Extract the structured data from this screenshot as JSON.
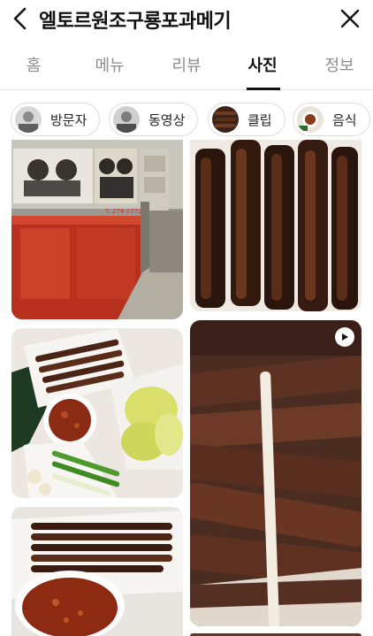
{
  "header": {
    "title": "엘토르원조구룡포과메기",
    "back_icon": "chevron-left-icon",
    "close_icon": "close-icon"
  },
  "tabs": [
    {
      "label": "홈",
      "active": false
    },
    {
      "label": "메뉴",
      "active": false
    },
    {
      "label": "리뷰",
      "active": false
    },
    {
      "label": "사진",
      "active": true
    },
    {
      "label": "정보",
      "active": false
    }
  ],
  "filters": [
    {
      "label": "방문자"
    },
    {
      "label": "동영상"
    },
    {
      "label": "클립"
    },
    {
      "label": "음식"
    }
  ],
  "photos": {
    "storefront_phone": "T. 274-1772",
    "video_badge_icon": "play-icon"
  }
}
